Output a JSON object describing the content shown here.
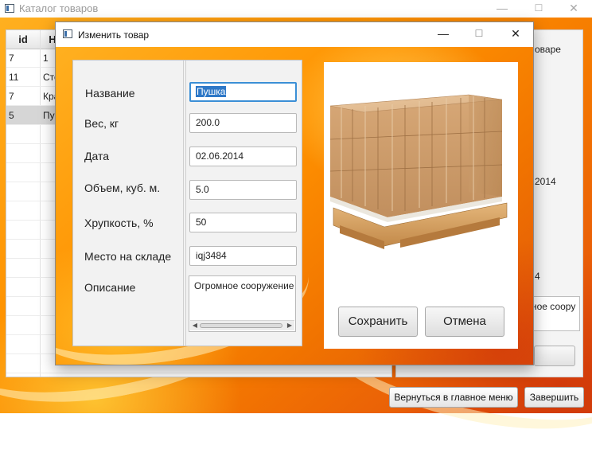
{
  "main_window": {
    "title": "Каталог товаров",
    "controls": {
      "minimize": "—",
      "maximize": "☐",
      "close": "✕"
    }
  },
  "table": {
    "columns": [
      "id",
      "Н"
    ],
    "rows": [
      {
        "id": "7",
        "name": "1"
      },
      {
        "id": "11",
        "name": "Сто"
      },
      {
        "id": "7",
        "name": "Кра"
      },
      {
        "id": "5",
        "name": "Пу",
        "selected": true
      }
    ]
  },
  "side_panel": {
    "text_top": "оваре",
    "text_date": "2014",
    "text_num": "4",
    "textarea": "ное соору"
  },
  "bottom": {
    "back_button": "Вернуться в главное меню",
    "exit_button": "Завершить"
  },
  "dialog": {
    "title": "Изменить товар",
    "controls": {
      "minimize": "—",
      "maximize": "☐",
      "close": "✕"
    },
    "fields": {
      "name": {
        "label": "Название",
        "value": "Пушка"
      },
      "weight": {
        "label": "Вес, кг",
        "value": "200.0"
      },
      "date": {
        "label": "Дата",
        "value": "02.06.2014"
      },
      "volume": {
        "label": "Объем, куб. м.",
        "value": "5.0"
      },
      "fragility": {
        "label": "Хрупкость, %",
        "value": "50"
      },
      "location": {
        "label": "Место на складе",
        "value": "iqj3484"
      },
      "description": {
        "label": "Описание",
        "value": "Огромное сооружение"
      }
    },
    "save_button": "Сохранить",
    "cancel_button": "Отмена",
    "image_icon": "pallet-boxes-image"
  }
}
